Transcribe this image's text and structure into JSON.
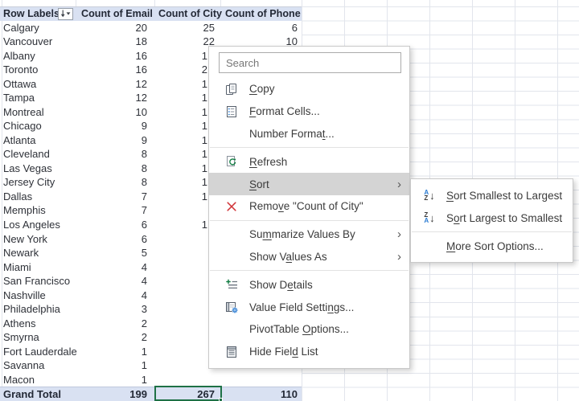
{
  "pivot_table": {
    "columns": [
      "Row Labels",
      "Count of Email",
      "Count of City",
      "Count of Phone"
    ],
    "rows": [
      {
        "label": "Calgary",
        "email": "20",
        "city": "25",
        "phone": "6",
        "city_partial": false
      },
      {
        "label": "Vancouver",
        "email": "18",
        "city": "22",
        "phone": "10",
        "city_partial": false
      },
      {
        "label": "Albany",
        "email": "16",
        "city": "1",
        "phone": "",
        "city_partial": true
      },
      {
        "label": "Toronto",
        "email": "16",
        "city": "2",
        "phone": "",
        "city_partial": true
      },
      {
        "label": "Ottawa",
        "email": "12",
        "city": "1",
        "phone": "",
        "city_partial": true
      },
      {
        "label": "Tampa",
        "email": "12",
        "city": "1",
        "phone": "",
        "city_partial": true
      },
      {
        "label": "Montreal",
        "email": "10",
        "city": "1",
        "phone": "",
        "city_partial": true
      },
      {
        "label": "Chicago",
        "email": "9",
        "city": "1",
        "phone": "",
        "city_partial": true
      },
      {
        "label": "Atlanta",
        "email": "9",
        "city": "1",
        "phone": "",
        "city_partial": true
      },
      {
        "label": "Cleveland",
        "email": "8",
        "city": "1",
        "phone": "",
        "city_partial": true
      },
      {
        "label": "Las Vegas",
        "email": "8",
        "city": "1",
        "phone": "",
        "city_partial": true
      },
      {
        "label": "Jersey City",
        "email": "8",
        "city": "1",
        "phone": "",
        "city_partial": true
      },
      {
        "label": "Dallas",
        "email": "7",
        "city": "1",
        "phone": "",
        "city_partial": true
      },
      {
        "label": "Memphis",
        "email": "7",
        "city": "",
        "phone": "",
        "city_partial": false
      },
      {
        "label": "Los Angeles",
        "email": "6",
        "city": "1",
        "phone": "",
        "city_partial": true
      },
      {
        "label": "New York",
        "email": "6",
        "city": "",
        "phone": "",
        "city_partial": false
      },
      {
        "label": "Newark",
        "email": "5",
        "city": "",
        "phone": "",
        "city_partial": false
      },
      {
        "label": "Miami",
        "email": "4",
        "city": "",
        "phone": "",
        "city_partial": false
      },
      {
        "label": "San Francisco",
        "email": "4",
        "city": "",
        "phone": "",
        "city_partial": false
      },
      {
        "label": "Nashville",
        "email": "4",
        "city": "",
        "phone": "",
        "city_partial": false
      },
      {
        "label": "Philadelphia",
        "email": "3",
        "city": "",
        "phone": "",
        "city_partial": false
      },
      {
        "label": "Athens",
        "email": "2",
        "city": "",
        "phone": "",
        "city_partial": false
      },
      {
        "label": "Smyrna",
        "email": "2",
        "city": "",
        "phone": "",
        "city_partial": false
      },
      {
        "label": "Fort Lauderdale",
        "email": "1",
        "city": "",
        "phone": "",
        "city_partial": false
      },
      {
        "label": "Savanna",
        "email": "1",
        "city": "",
        "phone": "",
        "city_partial": false
      },
      {
        "label": "Macon",
        "email": "1",
        "city": "",
        "phone": "",
        "city_partial": false
      }
    ],
    "grand_total": {
      "label": "Grand Total",
      "email": "199",
      "city": "267",
      "phone": "110"
    },
    "selected_cell_value": "267",
    "row_labels_filter_icon": "sort-filter-icon"
  },
  "context_menu": {
    "search": {
      "placeholder": "Search"
    },
    "items": [
      {
        "pre": "",
        "key": "C",
        "post": "opy",
        "icon": "copy-icon"
      },
      {
        "pre": "",
        "key": "F",
        "post": "ormat Cells...",
        "icon": "format-cells-icon"
      },
      {
        "pre": "Number Forma",
        "key": "t",
        "post": "...",
        "icon": ""
      },
      {
        "pre": "",
        "key": "R",
        "post": "efresh",
        "icon": "refresh-icon"
      },
      {
        "pre": "",
        "key": "S",
        "post": "ort",
        "icon": "",
        "has_submenu": true,
        "highlighted": true
      },
      {
        "pre": "Remo",
        "key": "v",
        "post": "e \"Count of City\"",
        "icon": "remove-icon"
      },
      {
        "pre": "Su",
        "key": "m",
        "post": "marize Values By",
        "icon": "",
        "has_submenu": true
      },
      {
        "pre": "Show V",
        "key": "a",
        "post": "lues As",
        "icon": "",
        "has_submenu": true
      },
      {
        "pre": "Show D",
        "key": "e",
        "post": "tails",
        "icon": "show-details-icon"
      },
      {
        "pre": "Value Field Setti",
        "key": "n",
        "post": "gs...",
        "icon": "value-field-settings-icon"
      },
      {
        "pre": "PivotTable ",
        "key": "O",
        "post": "ptions...",
        "icon": ""
      },
      {
        "pre": "Hide Fiel",
        "key": "d",
        "post": " List",
        "icon": "hide-field-list-icon"
      }
    ]
  },
  "sort_submenu": {
    "items": [
      {
        "pre": "",
        "key": "S",
        "post": "ort Smallest to Largest",
        "icon": "sort-az-icon"
      },
      {
        "pre": "S",
        "key": "o",
        "post": "rt Largest to Smallest",
        "icon": "sort-za-icon"
      },
      {
        "pre": "",
        "key": "M",
        "post": "ore Sort Options...",
        "icon": ""
      }
    ]
  },
  "colors": {
    "header_bg": "#d9e1f2",
    "grid": "#e2e5ec",
    "accent_green": "#1e7145",
    "highlight": "#d4d4d4",
    "remove_red": "#d13438",
    "sort_blue": "#2b7cd3",
    "menu_border": "#c9c9c9",
    "cell_text": "#2e3138",
    "header_text": "#232936"
  }
}
